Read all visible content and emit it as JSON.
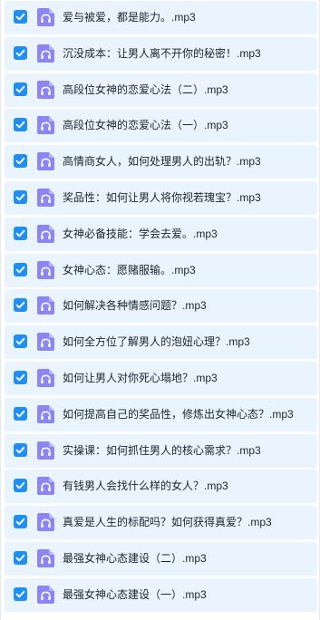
{
  "file_list": {
    "items": [
      {
        "name": "爱与被爱，都是能力。.mp3",
        "checked": true,
        "icon": "audio-file-icon"
      },
      {
        "name": "沉没成本：让男人离不开你的秘密！.mp3",
        "checked": true,
        "icon": "audio-file-icon"
      },
      {
        "name": "高段位女神的恋爱心法（二）.mp3",
        "checked": true,
        "icon": "audio-file-icon"
      },
      {
        "name": "高段位女神的恋爱心法（一）.mp3",
        "checked": true,
        "icon": "audio-file-icon"
      },
      {
        "name": "高情商女人，如何处理男人的出轨？.mp3",
        "checked": true,
        "icon": "audio-file-icon"
      },
      {
        "name": "奖品性：如何让男人将你视若瑰宝？.mp3",
        "checked": true,
        "icon": "audio-file-icon"
      },
      {
        "name": "女神必备技能：学会去爱。.mp3",
        "checked": true,
        "icon": "audio-file-icon"
      },
      {
        "name": "女神心态：愿赌服输。.mp3",
        "checked": true,
        "icon": "audio-file-icon"
      },
      {
        "name": "如何解决各种情感问题？.mp3",
        "checked": true,
        "icon": "audio-file-icon"
      },
      {
        "name": "如何全方位了解男人的泡妞心理？.mp3",
        "checked": true,
        "icon": "audio-file-icon"
      },
      {
        "name": "如何让男人对你死心塌地？.mp3",
        "checked": true,
        "icon": "audio-file-icon"
      },
      {
        "name": "如何提高自己的奖品性，修炼出女神心态？.mp3",
        "checked": true,
        "icon": "audio-file-icon"
      },
      {
        "name": "实操课：如何抓住男人的核心需求？.mp3",
        "checked": true,
        "icon": "audio-file-icon"
      },
      {
        "name": "有钱男人会找什么样的女人？.mp3",
        "checked": true,
        "icon": "audio-file-icon"
      },
      {
        "name": "真爱是人生的标配吗？如何获得真爱？.mp3",
        "checked": true,
        "icon": "audio-file-icon"
      },
      {
        "name": "最强女神心态建设（二）.mp3",
        "checked": true,
        "icon": "audio-file-icon"
      },
      {
        "name": "最强女神心态建设（一）.mp3",
        "checked": true,
        "icon": "audio-file-icon"
      }
    ]
  },
  "colors": {
    "row_background": "#e9f4ff",
    "checkbox": "#1f8ff4",
    "icon_background": "#8b86f4",
    "text": "#1d2530"
  }
}
